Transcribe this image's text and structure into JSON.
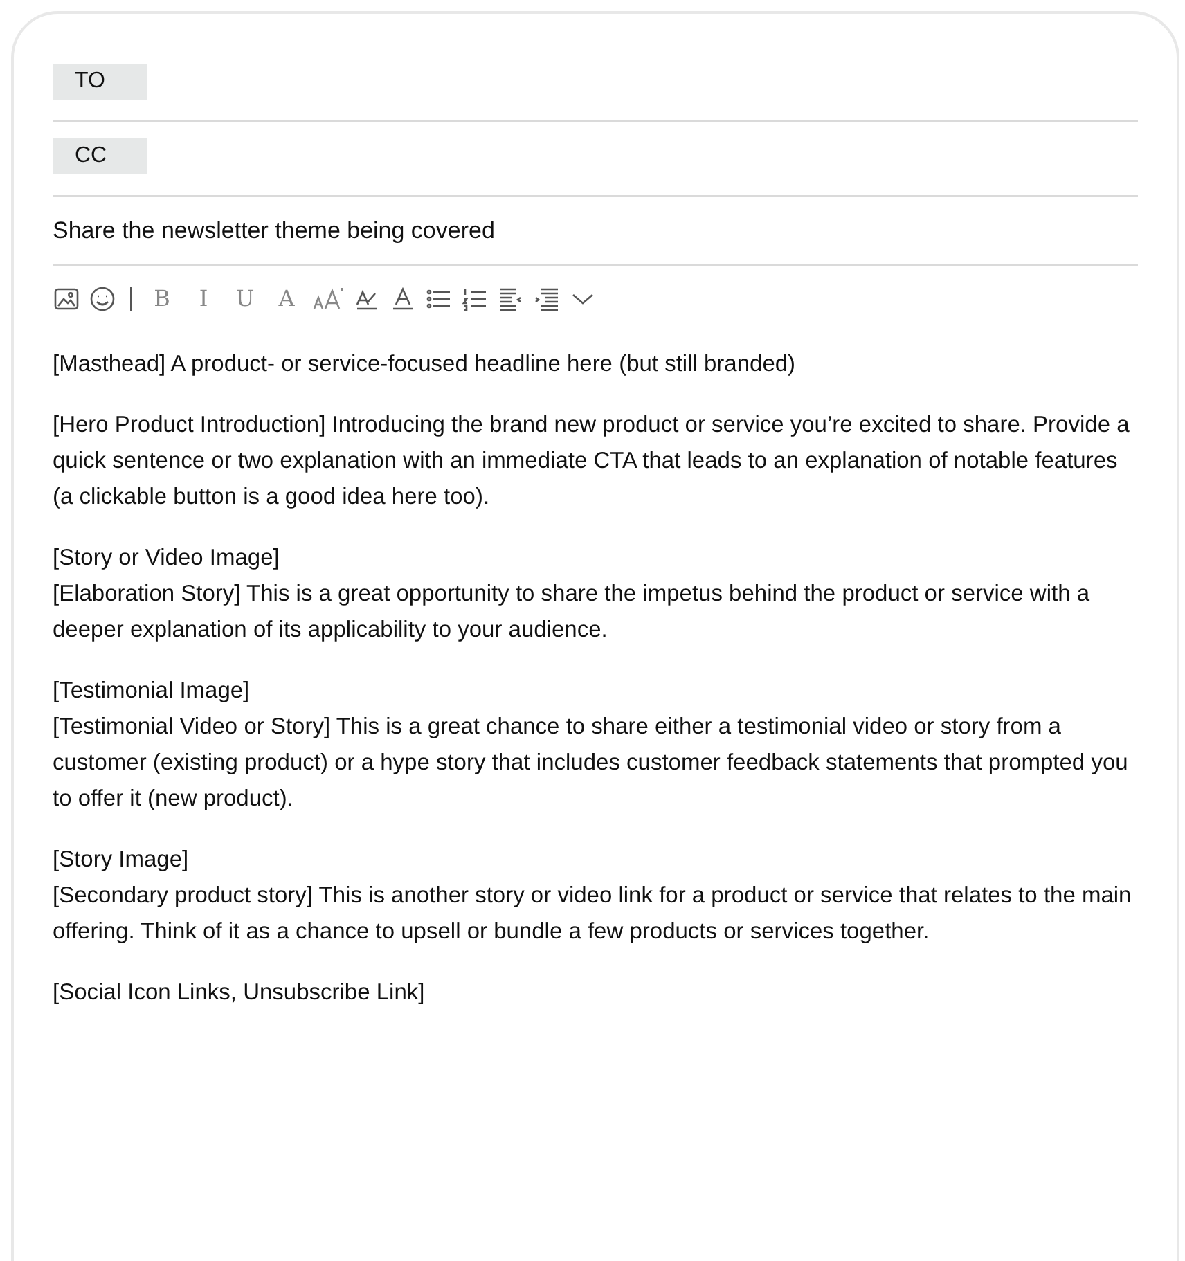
{
  "recipients": [
    {
      "label": "TO"
    },
    {
      "label": "CC"
    }
  ],
  "subject": "Share the newsletter theme being covered",
  "toolbar": [
    {
      "kind": "image"
    },
    {
      "kind": "emoji"
    },
    {
      "kind": "divider"
    },
    {
      "kind": "letter",
      "label": "B"
    },
    {
      "kind": "letter",
      "label": "I"
    },
    {
      "kind": "letter",
      "label": "U"
    },
    {
      "kind": "letter",
      "label": "A"
    },
    {
      "kind": "size"
    },
    {
      "kind": "highlight"
    },
    {
      "kind": "color"
    },
    {
      "kind": "bullets"
    },
    {
      "kind": "numbers"
    },
    {
      "kind": "outdent"
    },
    {
      "kind": "indent"
    },
    {
      "kind": "more"
    }
  ],
  "body": [
    [
      "[Masthead] A product- or service-focused headline here (but still branded)"
    ],
    [
      "[Hero Product Introduction] Introducing the brand new product or service you’re excited to share. Provide a quick sentence or two explanation with an immediate CTA that leads to an explanation of notable features (a clickable button is a good idea here too)."
    ],
    [
      "[Story or Video Image]",
      "[Elaboration Story] This is a great opportunity to share the impetus behind the product or service with a deeper explanation of its applicability to your audience."
    ],
    [
      "[Testimonial Image]",
      "[Testimonial Video or Story] This is a great chance to share either a testimonial video or story from a customer (existing product) or a hype story that includes customer feedback statements that prompted you to offer it (new product)."
    ],
    [
      "[Story Image]",
      "[Secondary product story] This is another story or video link for a product or service that relates to the main offering. Think of it as a chance to upsell or bundle a few products or services together."
    ],
    [
      "[Social Icon Links, Unsubscribe Link]"
    ]
  ]
}
